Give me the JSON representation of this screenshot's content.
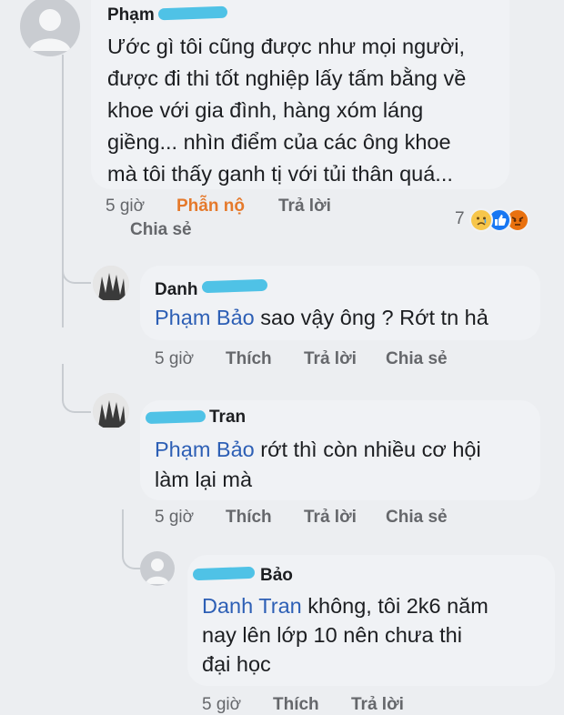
{
  "comment1": {
    "author": "Phạm",
    "text_lines": [
      "Ước gì tôi cũng được như mọi người,",
      "được đi thi tốt nghiệp lấy tấm bằng về",
      "khoe với gia đình, hàng xóm láng",
      "giềng... nhìn điểm của các ông khoe",
      "mà tôi thấy ganh tị với tủi thân quá..."
    ],
    "time": "5 giờ",
    "reaction_label": "Phẫn nộ",
    "reply": "Trả lời",
    "share": "Chia sẻ",
    "reaction_count": "7",
    "reaction_icons": [
      "sad-icon",
      "like-icon",
      "angry-icon"
    ]
  },
  "reply1": {
    "author": "Danh",
    "mention": "Phạm Bảo",
    "text": " sao vậy ông ? Rớt tn hả",
    "time": "5 giờ",
    "like": "Thích",
    "reply": "Trả lời",
    "share": "Chia sẻ"
  },
  "reply2": {
    "author": "Tran",
    "mention": "Phạm Bảo",
    "text_line1": " rớt thì còn nhiều cơ hội",
    "text_line2": "làm lại mà",
    "time": "5 giờ",
    "like": "Thích",
    "reply": "Trả lời",
    "share": "Chia sẻ"
  },
  "reply3": {
    "author": "Bảo",
    "mention": "Danh Tran",
    "text_line1": " không, tôi 2k6 năm",
    "text_line2": "nay lên lớp 10 nên chưa thi",
    "text_line3": "đại học",
    "time": "5 giờ",
    "like": "Thích",
    "reply": "Trả lời"
  }
}
